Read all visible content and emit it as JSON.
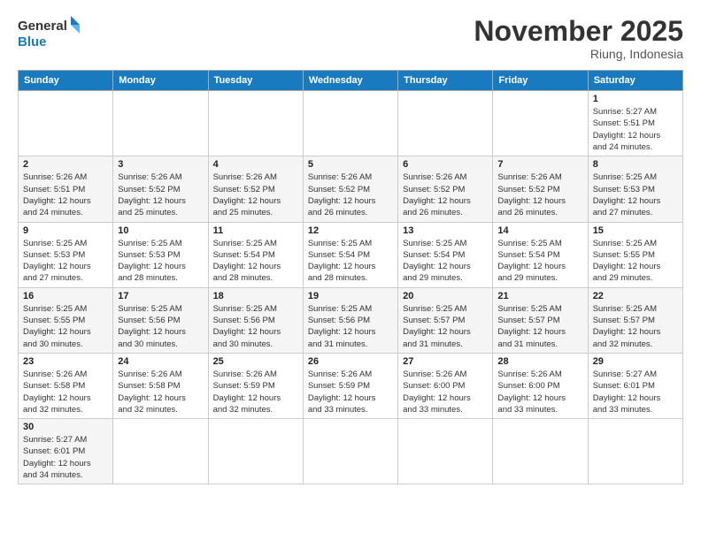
{
  "header": {
    "logo_general": "General",
    "logo_blue": "Blue",
    "month_title": "November 2025",
    "location": "Riung, Indonesia"
  },
  "weekdays": [
    "Sunday",
    "Monday",
    "Tuesday",
    "Wednesday",
    "Thursday",
    "Friday",
    "Saturday"
  ],
  "weeks": [
    [
      {
        "day": "",
        "info": ""
      },
      {
        "day": "",
        "info": ""
      },
      {
        "day": "",
        "info": ""
      },
      {
        "day": "",
        "info": ""
      },
      {
        "day": "",
        "info": ""
      },
      {
        "day": "",
        "info": ""
      },
      {
        "day": "1",
        "info": "Sunrise: 5:27 AM\nSunset: 5:51 PM\nDaylight: 12 hours\nand 24 minutes."
      }
    ],
    [
      {
        "day": "2",
        "info": "Sunrise: 5:26 AM\nSunset: 5:51 PM\nDaylight: 12 hours\nand 24 minutes."
      },
      {
        "day": "3",
        "info": "Sunrise: 5:26 AM\nSunset: 5:52 PM\nDaylight: 12 hours\nand 25 minutes."
      },
      {
        "day": "4",
        "info": "Sunrise: 5:26 AM\nSunset: 5:52 PM\nDaylight: 12 hours\nand 25 minutes."
      },
      {
        "day": "5",
        "info": "Sunrise: 5:26 AM\nSunset: 5:52 PM\nDaylight: 12 hours\nand 26 minutes."
      },
      {
        "day": "6",
        "info": "Sunrise: 5:26 AM\nSunset: 5:52 PM\nDaylight: 12 hours\nand 26 minutes."
      },
      {
        "day": "7",
        "info": "Sunrise: 5:26 AM\nSunset: 5:52 PM\nDaylight: 12 hours\nand 26 minutes."
      },
      {
        "day": "8",
        "info": "Sunrise: 5:25 AM\nSunset: 5:53 PM\nDaylight: 12 hours\nand 27 minutes."
      }
    ],
    [
      {
        "day": "9",
        "info": "Sunrise: 5:25 AM\nSunset: 5:53 PM\nDaylight: 12 hours\nand 27 minutes."
      },
      {
        "day": "10",
        "info": "Sunrise: 5:25 AM\nSunset: 5:53 PM\nDaylight: 12 hours\nand 28 minutes."
      },
      {
        "day": "11",
        "info": "Sunrise: 5:25 AM\nSunset: 5:54 PM\nDaylight: 12 hours\nand 28 minutes."
      },
      {
        "day": "12",
        "info": "Sunrise: 5:25 AM\nSunset: 5:54 PM\nDaylight: 12 hours\nand 28 minutes."
      },
      {
        "day": "13",
        "info": "Sunrise: 5:25 AM\nSunset: 5:54 PM\nDaylight: 12 hours\nand 29 minutes."
      },
      {
        "day": "14",
        "info": "Sunrise: 5:25 AM\nSunset: 5:54 PM\nDaylight: 12 hours\nand 29 minutes."
      },
      {
        "day": "15",
        "info": "Sunrise: 5:25 AM\nSunset: 5:55 PM\nDaylight: 12 hours\nand 29 minutes."
      }
    ],
    [
      {
        "day": "16",
        "info": "Sunrise: 5:25 AM\nSunset: 5:55 PM\nDaylight: 12 hours\nand 30 minutes."
      },
      {
        "day": "17",
        "info": "Sunrise: 5:25 AM\nSunset: 5:56 PM\nDaylight: 12 hours\nand 30 minutes."
      },
      {
        "day": "18",
        "info": "Sunrise: 5:25 AM\nSunset: 5:56 PM\nDaylight: 12 hours\nand 30 minutes."
      },
      {
        "day": "19",
        "info": "Sunrise: 5:25 AM\nSunset: 5:56 PM\nDaylight: 12 hours\nand 31 minutes."
      },
      {
        "day": "20",
        "info": "Sunrise: 5:25 AM\nSunset: 5:57 PM\nDaylight: 12 hours\nand 31 minutes."
      },
      {
        "day": "21",
        "info": "Sunrise: 5:25 AM\nSunset: 5:57 PM\nDaylight: 12 hours\nand 31 minutes."
      },
      {
        "day": "22",
        "info": "Sunrise: 5:25 AM\nSunset: 5:57 PM\nDaylight: 12 hours\nand 32 minutes."
      }
    ],
    [
      {
        "day": "23",
        "info": "Sunrise: 5:26 AM\nSunset: 5:58 PM\nDaylight: 12 hours\nand 32 minutes."
      },
      {
        "day": "24",
        "info": "Sunrise: 5:26 AM\nSunset: 5:58 PM\nDaylight: 12 hours\nand 32 minutes."
      },
      {
        "day": "25",
        "info": "Sunrise: 5:26 AM\nSunset: 5:59 PM\nDaylight: 12 hours\nand 32 minutes."
      },
      {
        "day": "26",
        "info": "Sunrise: 5:26 AM\nSunset: 5:59 PM\nDaylight: 12 hours\nand 33 minutes."
      },
      {
        "day": "27",
        "info": "Sunrise: 5:26 AM\nSunset: 6:00 PM\nDaylight: 12 hours\nand 33 minutes."
      },
      {
        "day": "28",
        "info": "Sunrise: 5:26 AM\nSunset: 6:00 PM\nDaylight: 12 hours\nand 33 minutes."
      },
      {
        "day": "29",
        "info": "Sunrise: 5:27 AM\nSunset: 6:01 PM\nDaylight: 12 hours\nand 33 minutes."
      }
    ],
    [
      {
        "day": "30",
        "info": "Sunrise: 5:27 AM\nSunset: 6:01 PM\nDaylight: 12 hours\nand 34 minutes."
      },
      {
        "day": "",
        "info": ""
      },
      {
        "day": "",
        "info": ""
      },
      {
        "day": "",
        "info": ""
      },
      {
        "day": "",
        "info": ""
      },
      {
        "day": "",
        "info": ""
      },
      {
        "day": "",
        "info": ""
      }
    ]
  ]
}
